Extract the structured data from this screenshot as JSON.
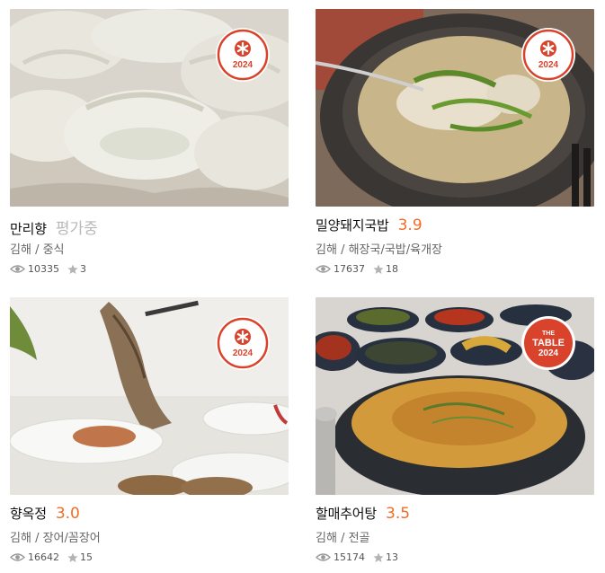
{
  "restaurants": [
    {
      "name": "만리향",
      "rating": "평가중",
      "location": "김해",
      "category": "중식",
      "views": "10335",
      "reviews": "3",
      "badge_year": "2024",
      "badge_label": "",
      "photo": "dumplings"
    },
    {
      "name": "밀양돼지국밥",
      "rating": "3.9",
      "location": "김해",
      "category": "해장국/국밥/육개장",
      "views": "17637",
      "reviews": "18",
      "badge_year": "2024",
      "badge_label": "",
      "photo": "pork-soup"
    },
    {
      "name": "향옥정",
      "rating": "3.0",
      "location": "김해",
      "category": "장어/꼼장어",
      "views": "16642",
      "reviews": "15",
      "badge_year": "2024",
      "badge_label": "",
      "photo": "grilled-eel"
    },
    {
      "name": "할매추어탕",
      "rating": "3.5",
      "location": "김해",
      "category": "전골",
      "views": "15174",
      "reviews": "13",
      "badge_year": "2024",
      "badge_label": "THE TABLE",
      "photo": "loach-soup"
    }
  ],
  "separator": "/",
  "icons": {
    "views": "eye-icon",
    "reviews": "star-icon",
    "badge": "asterisk-icon"
  },
  "colors": {
    "accent": "#f26c24",
    "badge_red": "#d9432b",
    "pending": "#b9b9b9"
  }
}
